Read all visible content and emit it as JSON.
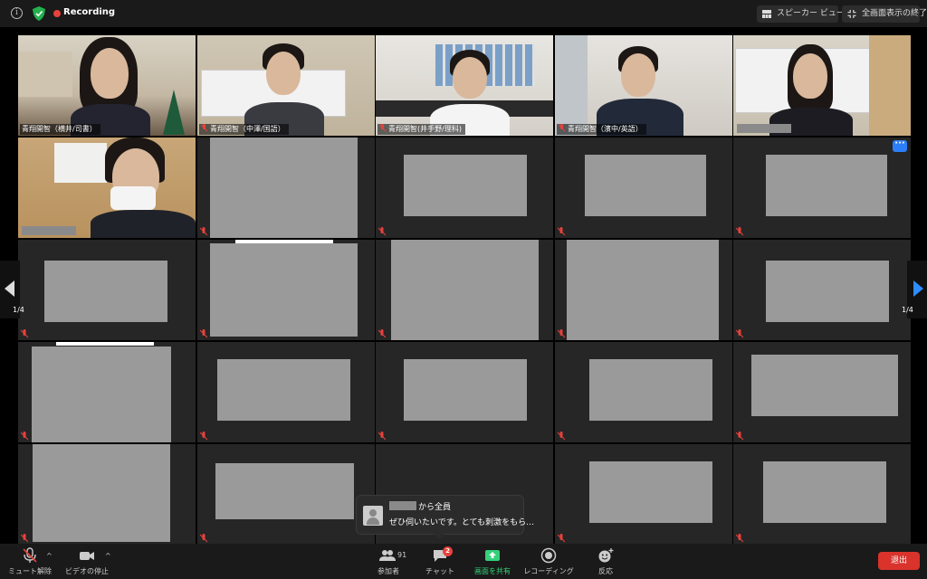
{
  "topbar": {
    "recording_label": "Recording",
    "speaker_view_label": "スピーカー ビュー",
    "exit_fullscreen_label": "全画面表示の終了"
  },
  "tiles": [
    {
      "name": "青翔開智（横井/司書）",
      "muted": false,
      "video": true
    },
    {
      "name": "青翔開智（中澤/国語）",
      "muted": true,
      "video": true
    },
    {
      "name": "青翔開智(井手野/理科)",
      "muted": true,
      "video": true
    },
    {
      "name": "青翔開智（濱中/英語）",
      "muted": true,
      "video": true
    }
  ],
  "page": {
    "left_indicator": "1/4",
    "right_indicator": "1/4"
  },
  "chat": {
    "from_suffix": "から全員",
    "message": "ぜひ伺いたいです。とても刺激をもら…"
  },
  "toolbar": {
    "unmute_label": "ミュート解除",
    "stop_video_label": "ビデオの停止",
    "participants_label": "参加者",
    "participants_count": "91",
    "chat_label": "チャット",
    "chat_badge": "2",
    "share_label": "画面を共有",
    "record_label": "レコーディング",
    "reactions_label": "反応",
    "end_label": "退出"
  },
  "colors": {
    "accent_blue": "#2d8cff",
    "share_green": "#35d07a",
    "end_red": "#d9332c",
    "active_speaker": "#d6d36a"
  }
}
